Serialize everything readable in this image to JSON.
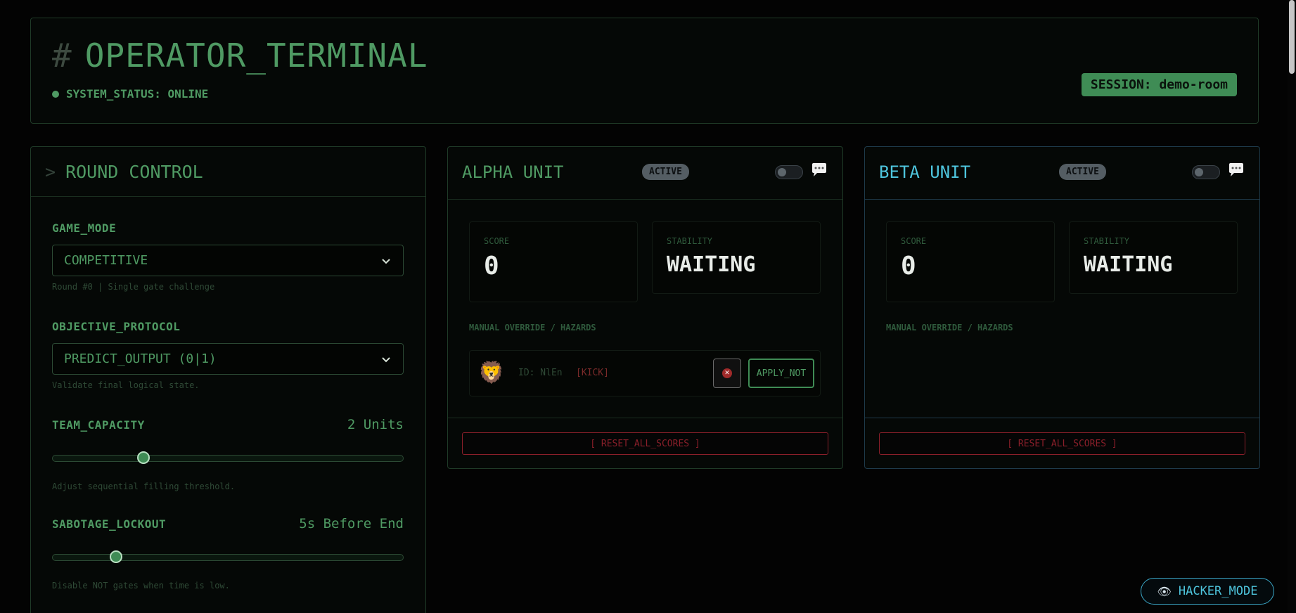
{
  "header": {
    "hash": "#",
    "title": "OPERATOR_TERMINAL",
    "status": "SYSTEM_STATUS: ONLINE",
    "session": "SESSION: demo-room"
  },
  "round_control": {
    "prompt": ">",
    "title": "ROUND CONTROL",
    "game_mode": {
      "label": "GAME_MODE",
      "value": "COMPETITIVE",
      "hint": "Round #0 | Single gate challenge"
    },
    "objective": {
      "label": "OBJECTIVE_PROTOCOL",
      "value": "PREDICT_OUTPUT (0|1)",
      "hint": "Validate final logical state."
    },
    "team_capacity": {
      "label": "TEAM_CAPACITY",
      "value": "2 Units",
      "level": 0.26,
      "hint": "Adjust sequential filling threshold."
    },
    "sabotage": {
      "label": "SABOTAGE_LOCKOUT",
      "value": "5s Before End",
      "level": 0.18,
      "hint": "Disable NOT gates when time is low."
    }
  },
  "alpha": {
    "name": "ALPHA UNIT",
    "badge": "ACTIVE",
    "score_label": "SCORE",
    "score": "0",
    "stability_label": "STABILITY",
    "stability": "WAITING",
    "override_label": "MANUAL OVERRIDE / HAZARDS",
    "player": {
      "avatar": "🦁",
      "id": "ID: NlEn",
      "kick": "[KICK]",
      "apply": "APPLY_NOT"
    },
    "reset": "[ RESET_ALL_SCORES ]"
  },
  "beta": {
    "name": "BETA UNIT",
    "badge": "ACTIVE",
    "score_label": "SCORE",
    "score": "0",
    "stability_label": "STABILITY",
    "stability": "WAITING",
    "override_label": "MANUAL OVERRIDE / HAZARDS",
    "reset": "[ RESET_ALL_SCORES ]"
  },
  "hacker_mode": {
    "icon": "👁",
    "label": "HACKER_MODE"
  },
  "colors": {
    "accent_green": "#4f9a63",
    "accent_cyan": "#4ec5dd",
    "danger": "#8a1f2a"
  }
}
